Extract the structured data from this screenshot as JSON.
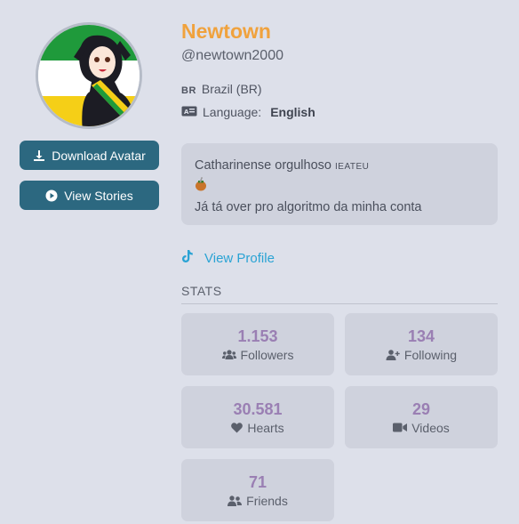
{
  "profile": {
    "name": "Newtown",
    "handle": "@newtown2000",
    "country_code": "BR",
    "country": "Brazil (BR)",
    "language_label": "Language:",
    "language": "English"
  },
  "buttons": {
    "download_avatar": "Download Avatar",
    "view_stories": "View Stories"
  },
  "bio": {
    "line1": "Catharinense orgulhoso",
    "line1_small": "IEATEU",
    "line2_icon": "mate-gourd-emoji",
    "line3": "Já tá over pro algoritmo da minha conta"
  },
  "links": {
    "view_profile": "View Profile",
    "view_profile_icon": "tiktok-icon"
  },
  "stats": {
    "heading": "STATS",
    "followers": {
      "value": "1.153",
      "label": "Followers",
      "icon": "users-icon"
    },
    "following": {
      "value": "134",
      "label": "Following",
      "icon": "user-plus-icon"
    },
    "hearts": {
      "value": "30.581",
      "label": "Hearts",
      "icon": "heart-icon"
    },
    "videos": {
      "value": "29",
      "label": "Videos",
      "icon": "video-icon"
    },
    "friends": {
      "value": "71",
      "label": "Friends",
      "icon": "user-friends-icon"
    }
  },
  "colors": {
    "background": "#dde0ea",
    "card": "#cfd2dd",
    "button": "#2c6880",
    "name_accent": "#f0a23d",
    "stat_number": "#9a7fb3",
    "link": "#2aa3d4"
  }
}
